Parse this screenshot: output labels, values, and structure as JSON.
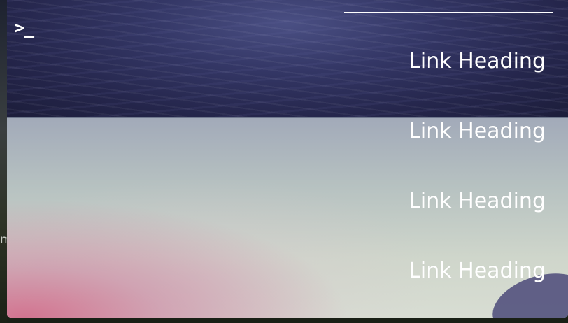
{
  "terminal_icon": "terminal-prompt-icon",
  "terminal_glyph": ">_",
  "background_fragment": "m",
  "nav": {
    "links": [
      {
        "label": "Link Heading"
      },
      {
        "label": "Link Heading"
      },
      {
        "label": "Link Heading"
      },
      {
        "label": "Link Heading"
      }
    ]
  },
  "colors": {
    "text": "#ffffff",
    "water": "#2b2e5a",
    "sky": "#cfd6cb",
    "rule": "#ffffff"
  }
}
